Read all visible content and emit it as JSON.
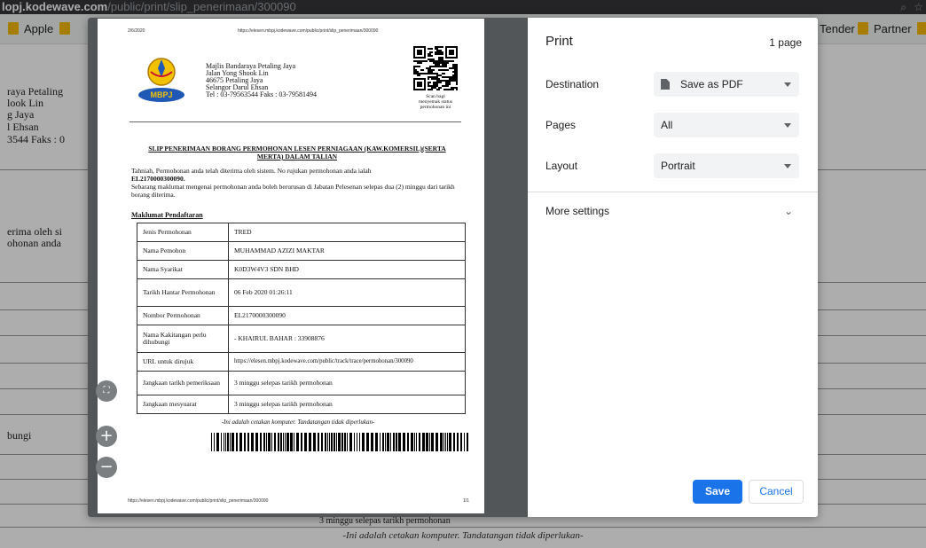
{
  "browser": {
    "url_domain": "lopj.kodewave.com",
    "url_path": "/public/print/slip_penerimaan/300090",
    "bookmarks": {
      "apple": "Apple",
      "tender": "Tender",
      "partner": "Partner"
    }
  },
  "background_page": {
    "address_lines": [
      "raya Petaling",
      "look Lin",
      "g Jaya",
      "l Ehsan",
      "3544 Faks : 0"
    ],
    "body_lines": [
      "erima oleh si",
      "ohonan anda"
    ],
    "dihubungi_fragment": "bungi",
    "table_row_fragment": "3 minggu selepas tarikh permohonan",
    "footer_note": "-Ini adalah cetakan komputer. Tandatangan tidak diperlukan-"
  },
  "print_preview": {
    "header_date": "2/6/2020",
    "header_url": "https://elesen.mbpj.kodewave.com/public/print/slip_penerimaan/300090",
    "logo_text": "MBPJ",
    "address": [
      "Majlis Bandaraya Petaling Jaya",
      "Jalan Yong Shook Lin",
      "46675 Petaling Jaya",
      "Selangor Darul Ehsan",
      "Tel : 03-79563544 Faks : 03-79581494"
    ],
    "qr_caption": [
      "Scan bagi",
      "menyemak status",
      "permohonan ini"
    ],
    "title": "SLIP PENERIMAAN BORANG PERMOHONAN LESEN PERNIAGAAN (KAW.KOMERSIL)(SERTA MERTA) DALAM TALIAN",
    "para1": "Tahniah, Permohonan anda telah diterima oleh sistem. No rujukan permohonan anda ialah",
    "reference_no": "EL2170000300090.",
    "para2": "Sebarang maklumat mengenai permohonan anda boleh berurusan di Jabatan Pelesenan selepas dua (2) minggu dari tarikh borang diterima.",
    "section_title": "Maklumat Pendaftaran",
    "rows": [
      {
        "label": "Jenis Permohonan",
        "value": "TRED"
      },
      {
        "label": "Nama Pemohon",
        "value": "MUHAMMAD AZIZI MAKTAR"
      },
      {
        "label": "Nama Syarikat",
        "value": "K0D3W4V3 SDN BHD"
      },
      {
        "label": "Tarikh Hantar Permohonan",
        "value": "06 Feb 2020 01:26:11"
      },
      {
        "label": "Nombor Permohonan",
        "value": "EL2170000300090"
      },
      {
        "label": "Nama Kakitangan perlu dihubungi",
        "value": "- KHAIRUL BAHAR : 33908876"
      },
      {
        "label": "URL untuk dirujuk",
        "value": "https://elesen.mbpj.kodewave.com/public/track/trace/permohonan/300090"
      },
      {
        "label": "Jangkaan tarikh pemeriksaan",
        "value": "3 minggu selepas tarikh permohonan"
      },
      {
        "label": "Jangkaan mesyuarat",
        "value": "3 minggu selepas tarikh permohonan"
      }
    ],
    "note": "-Ini adalah cetakan komputer. Tandatangan tidak diperlukan-",
    "footer_url": "https://elesen.mbpj.kodewave.com/public/print/slip_penerimaan/300090",
    "footer_page": "1/1"
  },
  "print_settings": {
    "title": "Print",
    "page_count": "1 page",
    "destination_label": "Destination",
    "destination_value": "Save as PDF",
    "pages_label": "Pages",
    "pages_value": "All",
    "layout_label": "Layout",
    "layout_value": "Portrait",
    "more_settings": "More settings",
    "save_button": "Save",
    "cancel_button": "Cancel"
  },
  "icons": {
    "fit_to_page": "fit-page-icon",
    "zoom_in": "plus-icon",
    "zoom_out": "minus-icon",
    "document": "document-icon",
    "chevron": "chevron-down-icon",
    "caret": "caret-down-icon",
    "folder": "folder-icon"
  },
  "colors": {
    "accent": "#1a73e8",
    "preview_background": "#525659",
    "bookmark_folder": "#f6b800"
  }
}
